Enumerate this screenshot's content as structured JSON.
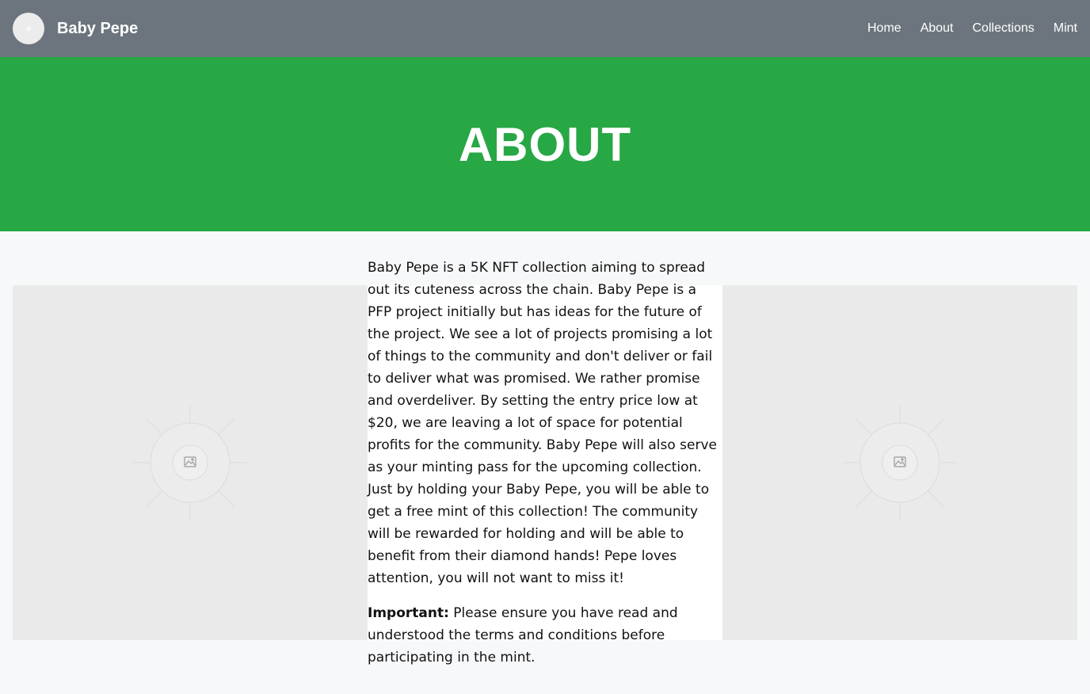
{
  "navbar": {
    "brand": "Baby Pepe",
    "links": [
      "Home",
      "About",
      "Collections",
      "Mint"
    ]
  },
  "hero": {
    "title": "ABOUT"
  },
  "about": {
    "paragraph": "Baby Pepe is a 5K NFT collection aiming to spread out its cuteness across the chain. Baby Pepe is a PFP project initially but has ideas for the future of the project. We see a lot of projects promising a lot of things to the community and don't deliver or fail to deliver what was promised. We rather promise and overdeliver. By setting the entry price low at $20, we are leaving a lot of space for potential profits for the community. Baby Pepe will also serve as your minting pass for the upcoming collection. Just by holding your Baby Pepe, you will be able to get a free mint of this collection! The community will be rewarded for holding and will be able to benefit from their diamond hands! Pepe loves attention, you will not want to miss it!",
    "important_label": "Important:",
    "important_text": " Please ensure you have read and understood the terms and conditions before participating in the mint."
  },
  "icons": {
    "logo": "avatar-placeholder-icon",
    "image_placeholder": "image-placeholder-icon"
  },
  "colors": {
    "navbar": "#6c757d",
    "hero": "#28a745",
    "page_bg": "#f7f8fa"
  }
}
